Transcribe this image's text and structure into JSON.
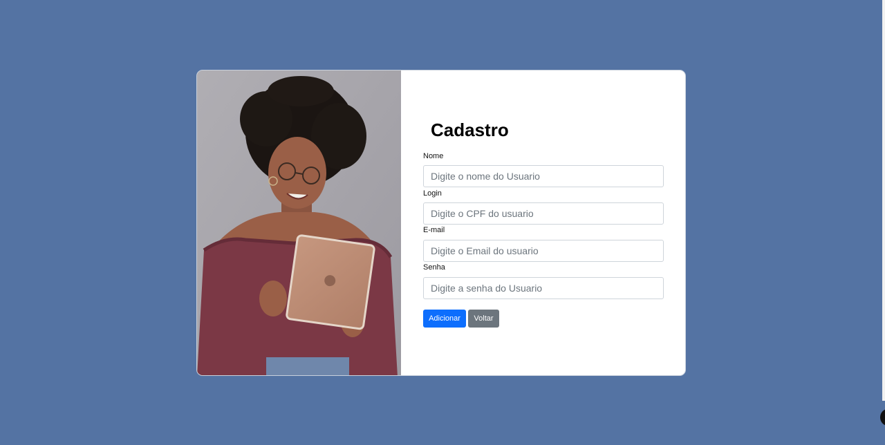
{
  "form": {
    "title": "Cadastro",
    "fields": [
      {
        "label": "Nome",
        "placeholder": "Digite o nome do Usuario",
        "value": ""
      },
      {
        "label": "Login",
        "placeholder": "Digite o CPF do usuario",
        "value": ""
      },
      {
        "label": "E-mail",
        "placeholder": "Digite o Email do usuario",
        "value": ""
      },
      {
        "label": "Senha",
        "placeholder": "Digite a senha do Usuario",
        "value": ""
      }
    ],
    "buttons": {
      "add_label": "Adicionar",
      "back_label": "Voltar"
    }
  },
  "colors": {
    "page_background": "#5473a3",
    "card_background": "#ffffff",
    "primary_button": "#0d6efd",
    "secondary_button": "#6c757d"
  },
  "image": {
    "subject": "woman-with-tablet-photo"
  }
}
